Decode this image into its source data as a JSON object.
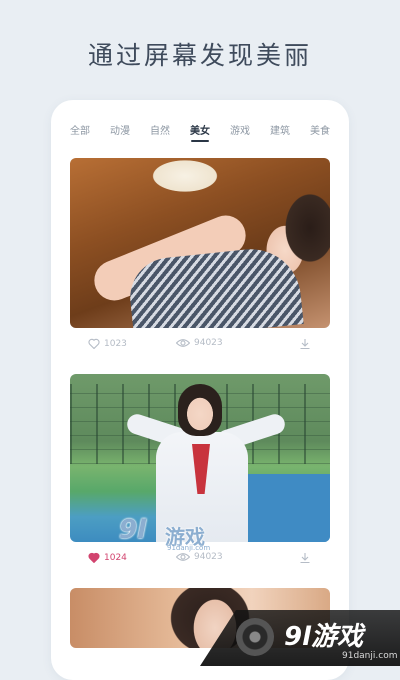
{
  "headline": "通过屏幕发现美丽",
  "tabs": [
    {
      "label": "全部",
      "active": false
    },
    {
      "label": "动漫",
      "active": false
    },
    {
      "label": "自然",
      "active": false
    },
    {
      "label": "美女",
      "active": true
    },
    {
      "label": "游戏",
      "active": false
    },
    {
      "label": "建筑",
      "active": false
    },
    {
      "label": "美食",
      "active": false
    }
  ],
  "cards": [
    {
      "likes": "1023",
      "liked": false,
      "views": "94023"
    },
    {
      "likes": "1024",
      "liked": true,
      "views": "94023"
    }
  ],
  "icons": {
    "like": "heart-icon",
    "views": "eye-icon",
    "download": "download-icon"
  },
  "watermark": {
    "logo": "9l",
    "title": "游戏",
    "url": "91danji.com"
  },
  "badge": {
    "logo": "9l游戏",
    "url": "91danji.com"
  },
  "colors": {
    "liked": "#d2446f",
    "active_tab": "#2a3645",
    "background": "#e9eef3"
  }
}
